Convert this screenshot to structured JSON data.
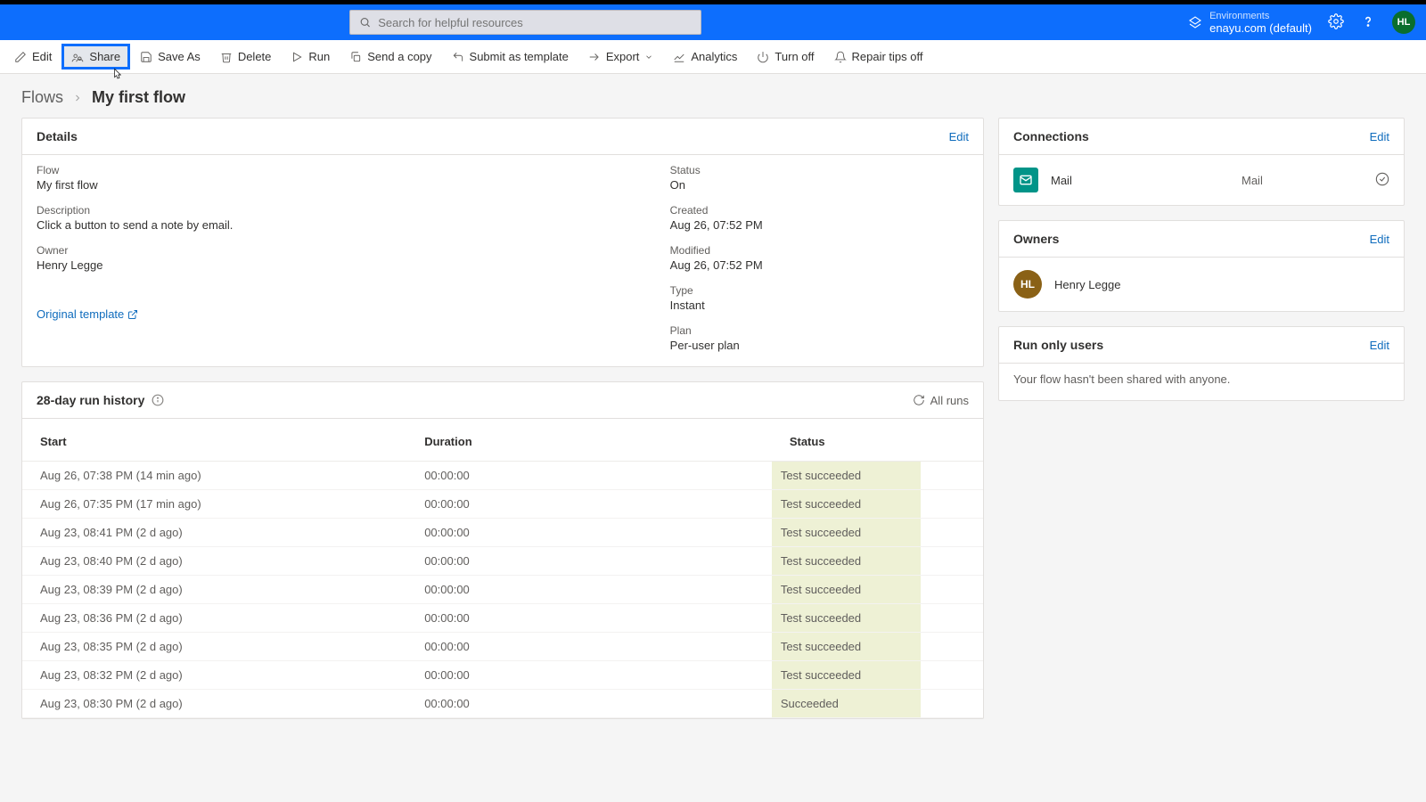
{
  "header": {
    "search_placeholder": "Search for helpful resources",
    "env_label": "Environments",
    "env_name": "enayu.com (default)",
    "avatar": "HL"
  },
  "cmdbar": {
    "edit": "Edit",
    "share": "Share",
    "save_as": "Save As",
    "delete": "Delete",
    "run": "Run",
    "send_copy": "Send a copy",
    "submit_tpl": "Submit as template",
    "export": "Export",
    "analytics": "Analytics",
    "turn_off": "Turn off",
    "repair_off": "Repair tips off"
  },
  "breadcrumb": {
    "root": "Flows",
    "current": "My first flow"
  },
  "details": {
    "title": "Details",
    "edit": "Edit",
    "flow_label": "Flow",
    "flow_value": "My first flow",
    "desc_label": "Description",
    "desc_value": "Click a button to send a note by email.",
    "owner_label": "Owner",
    "owner_value": "Henry Legge",
    "status_label": "Status",
    "status_value": "On",
    "created_label": "Created",
    "created_value": "Aug 26, 07:52 PM",
    "modified_label": "Modified",
    "modified_value": "Aug 26, 07:52 PM",
    "type_label": "Type",
    "type_value": "Instant",
    "plan_label": "Plan",
    "plan_value": "Per-user plan",
    "original_tpl": "Original template"
  },
  "runhistory": {
    "title": "28-day run history",
    "all_runs": "All runs",
    "col_start": "Start",
    "col_duration": "Duration",
    "col_status": "Status",
    "rows": [
      {
        "start": "Aug 26, 07:38 PM (14 min ago)",
        "duration": "00:00:00",
        "status": "Test succeeded"
      },
      {
        "start": "Aug 26, 07:35 PM (17 min ago)",
        "duration": "00:00:00",
        "status": "Test succeeded"
      },
      {
        "start": "Aug 23, 08:41 PM (2 d ago)",
        "duration": "00:00:00",
        "status": "Test succeeded"
      },
      {
        "start": "Aug 23, 08:40 PM (2 d ago)",
        "duration": "00:00:00",
        "status": "Test succeeded"
      },
      {
        "start": "Aug 23, 08:39 PM (2 d ago)",
        "duration": "00:00:00",
        "status": "Test succeeded"
      },
      {
        "start": "Aug 23, 08:36 PM (2 d ago)",
        "duration": "00:00:00",
        "status": "Test succeeded"
      },
      {
        "start": "Aug 23, 08:35 PM (2 d ago)",
        "duration": "00:00:00",
        "status": "Test succeeded"
      },
      {
        "start": "Aug 23, 08:32 PM (2 d ago)",
        "duration": "00:00:00",
        "status": "Test succeeded"
      },
      {
        "start": "Aug 23, 08:30 PM (2 d ago)",
        "duration": "00:00:00",
        "status": "Succeeded"
      }
    ]
  },
  "connections": {
    "title": "Connections",
    "edit": "Edit",
    "name": "Mail",
    "type": "Mail"
  },
  "owners": {
    "title": "Owners",
    "edit": "Edit",
    "avatar": "HL",
    "name": "Henry Legge"
  },
  "runonly": {
    "title": "Run only users",
    "edit": "Edit",
    "empty": "Your flow hasn't been shared with anyone."
  }
}
